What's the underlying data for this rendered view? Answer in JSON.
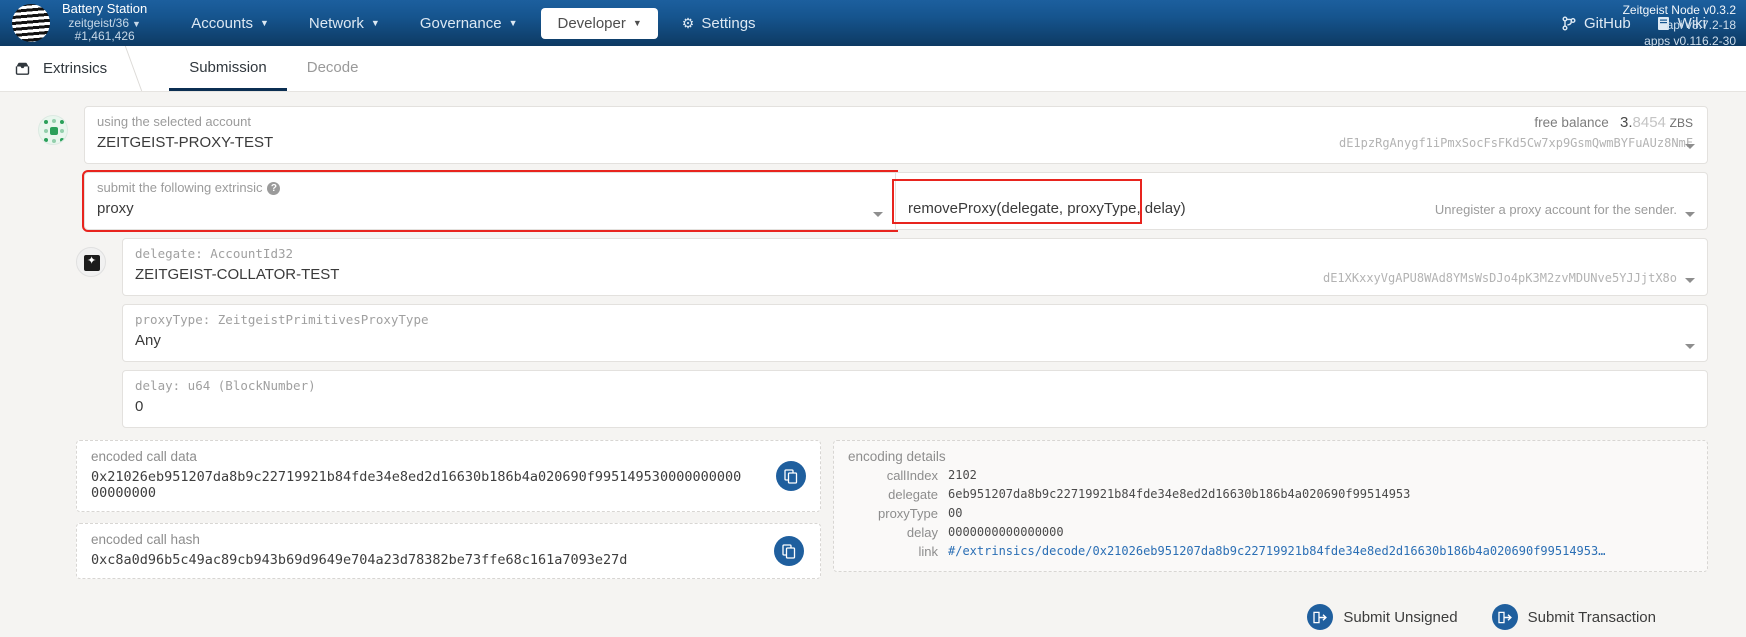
{
  "topbar": {
    "chain_name": "Battery Station",
    "chain_spec": "zeitgeist/36",
    "block_number": "#1,461,426",
    "nav": [
      {
        "label": "Accounts",
        "has_caret": true,
        "active": false
      },
      {
        "label": "Network",
        "has_caret": true,
        "active": false
      },
      {
        "label": "Governance",
        "has_caret": true,
        "active": false
      },
      {
        "label": "Developer",
        "has_caret": true,
        "active": true
      },
      {
        "label": "Settings",
        "has_caret": false,
        "active": false,
        "icon": "gear-icon"
      }
    ],
    "right_links": [
      {
        "label": "GitHub",
        "icon": "git-branch-icon"
      },
      {
        "label": "Wiki",
        "icon": "book-icon"
      }
    ],
    "versions": {
      "node": "Zeitgeist Node v0.3.2",
      "api": "api v8.7.2-18",
      "apps": "apps v0.116.2-30"
    }
  },
  "subheader": {
    "breadcrumb": "Extrinsics",
    "breadcrumb_icon": "inbox-icon",
    "tabs": [
      {
        "label": "Submission",
        "active": true
      },
      {
        "label": "Decode",
        "active": false
      }
    ]
  },
  "account": {
    "label": "using the selected account",
    "value": "ZEITGEIST-PROXY-TEST",
    "balance_label": "free balance",
    "balance_int": "3.",
    "balance_dec": "8454",
    "balance_unit": "ZBS",
    "address": "dE1pzRgAnygf1iPmxSocFsFKd5Cw7xp9GsmQwmBYFuAUz8NmF"
  },
  "extrinsic": {
    "section_label": "submit the following extrinsic",
    "section_value": "proxy",
    "method_value": "removeProxy(delegate, proxyType, delay)",
    "method_hint": "Unregister a proxy account for the sender.",
    "help_glyph": "?"
  },
  "params": [
    {
      "label": "delegate: AccountId32",
      "value": "ZEITGEIST-COLLATOR-TEST",
      "address": "dE1XKxxyVgAPU8WAd8YMsWsDJo4pK3M2zvMDUNve5YJJjtX8o",
      "has_icon": true,
      "has_caret": true,
      "mono_value": false
    },
    {
      "label": "proxyType: ZeitgeistPrimitivesProxyType",
      "value": "Any",
      "address": "",
      "has_icon": false,
      "has_caret": true,
      "mono_value": false
    },
    {
      "label": "delay: u64 (BlockNumber)",
      "value": "0",
      "address": "",
      "has_icon": false,
      "has_caret": false,
      "mono_value": false
    }
  ],
  "encoded": {
    "call_data_label": "encoded call data",
    "call_data_value": "0x21026eb951207da8b9c22719921b84fde34e8ed2d16630b186b4a020690f99514953000000000000000000",
    "call_hash_label": "encoded call hash",
    "call_hash_value": "0xc8a0d96b5c49ac89cb943b69d9649e704a23d78382be73ffe68c161a7093e27d",
    "copy_icon": "copy-icon"
  },
  "encoding_details": {
    "title": "encoding details",
    "rows": [
      {
        "key": "callIndex",
        "value": "2102",
        "is_link": false
      },
      {
        "key": "delegate",
        "value": "6eb951207da8b9c22719921b84fde34e8ed2d16630b186b4a020690f99514953",
        "is_link": false
      },
      {
        "key": "proxyType",
        "value": "00",
        "is_link": false
      },
      {
        "key": "delay",
        "value": "0000000000000000",
        "is_link": false
      },
      {
        "key": "link",
        "value": "#/extrinsics/decode/0x21026eb951207da8b9c22719921b84fde34e8ed2d16630b186b4a020690f99514953…",
        "is_link": true
      }
    ]
  },
  "footer": {
    "buttons": [
      {
        "label": "Submit Unsigned",
        "icon": "sign-in-icon"
      },
      {
        "label": "Submit Transaction",
        "icon": "sign-in-icon"
      }
    ]
  }
}
